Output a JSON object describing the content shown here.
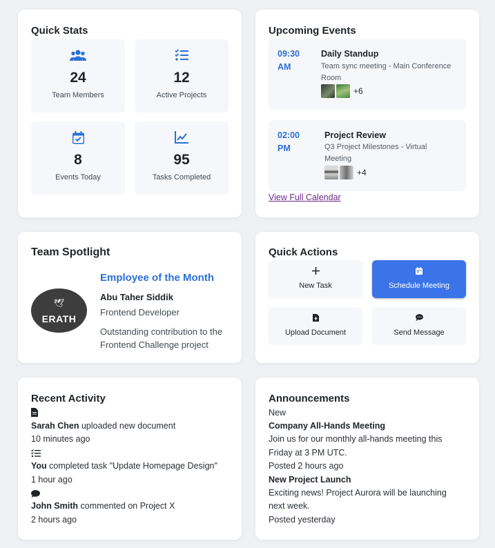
{
  "quick_stats": {
    "title": "Quick Stats",
    "items": [
      {
        "icon": "users-icon",
        "value": "24",
        "label": "Team Members"
      },
      {
        "icon": "checklist-icon",
        "value": "12",
        "label": "Active Projects"
      },
      {
        "icon": "calendar-check-icon",
        "value": "8",
        "label": "Events Today"
      },
      {
        "icon": "chart-line-icon",
        "value": "95",
        "label": "Tasks Completed"
      }
    ]
  },
  "upcoming_events": {
    "title": "Upcoming Events",
    "events": [
      {
        "time_line1": "09:30",
        "time_line2": "AM",
        "title": "Daily Standup",
        "desc_line1": "Team sync meeting - Main Conference",
        "desc_line2": "Room",
        "more": "+6"
      },
      {
        "time_line1": "02:00",
        "time_line2": "PM",
        "title": "Project Review",
        "desc_line1": "Q3 Project Milestones - Virtual",
        "desc_line2": "Meeting",
        "more": "+4"
      }
    ],
    "view_link": "View Full Calendar"
  },
  "team_spotlight": {
    "title": "Team Spotlight",
    "logo_text": "ERATH",
    "heading": "Employee of the Month",
    "name": "Abu Taher Siddik",
    "role": "Frontend Developer",
    "note_line1": "Outstanding contribution to the",
    "note_line2": "Frontend Challenge project"
  },
  "quick_actions": {
    "title": "Quick Actions",
    "items": [
      {
        "icon": "plus-icon",
        "label": "New Task"
      },
      {
        "icon": "calendar-icon",
        "label": "Schedule Meeting"
      },
      {
        "icon": "file-upload-icon",
        "label": "Upload Document"
      },
      {
        "icon": "chat-icon",
        "label": "Send Message"
      }
    ]
  },
  "recent_activity": {
    "title": "Recent Activity",
    "items": [
      {
        "icon": "document-icon",
        "actor": "Sarah Chen",
        "text": "uploaded new document",
        "time": "10 minutes ago"
      },
      {
        "icon": "checklist-icon",
        "actor": "You",
        "text": "completed task \"Update Homepage Design\"",
        "time": "1 hour ago"
      },
      {
        "icon": "comment-icon",
        "actor": "John Smith",
        "text": "commented on Project X",
        "time": "2 hours ago"
      }
    ]
  },
  "announcements": {
    "title": "Announcements",
    "tag": "New",
    "items": [
      {
        "title": "Company All-Hands Meeting",
        "body_line1": "Join us for our monthly all-hands meeting this",
        "body_line2": "Friday at 3 PM UTC.",
        "posted": "Posted 2 hours ago"
      },
      {
        "title": "New Project Launch",
        "body_line1": "Exciting news! Project Aurora will be launching",
        "body_line2": "next week.",
        "posted": "Posted yesterday"
      }
    ]
  },
  "colors": {
    "accent": "#2b6fd6",
    "primary_button": "#3b74e8",
    "link": "#6a2a8c",
    "background": "#eef0f4"
  }
}
